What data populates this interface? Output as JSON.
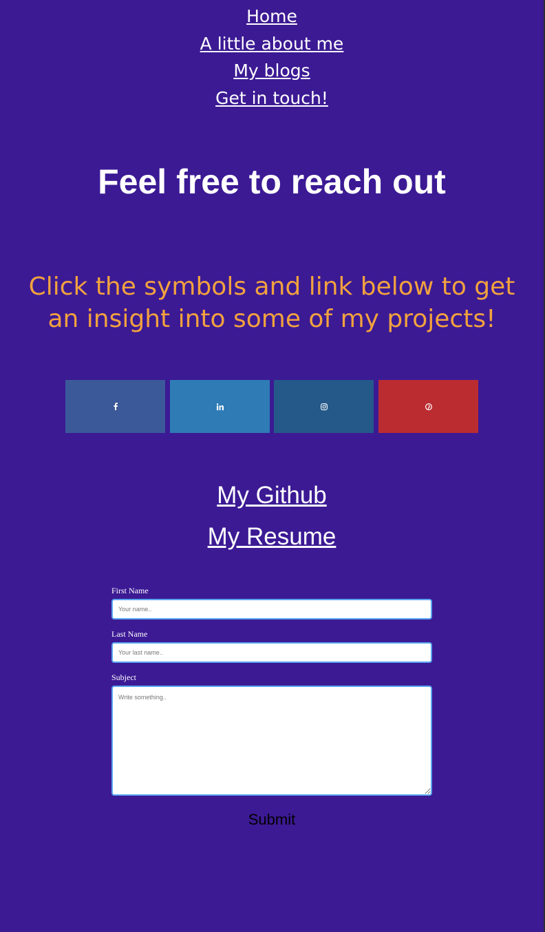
{
  "nav": {
    "items": [
      {
        "label": "Home"
      },
      {
        "label": "A little about me"
      },
      {
        "label": "My blogs"
      },
      {
        "label": "Get in touch!"
      }
    ]
  },
  "main": {
    "heading": "Feel free to reach out",
    "subheading": "Click the symbols and link below to get an insight into some of my projects!"
  },
  "socials": [
    {
      "icon": "facebook-icon",
      "color": "#3b5998"
    },
    {
      "icon": "linkedin-icon",
      "color": "#2f7bb6"
    },
    {
      "icon": "instagram-icon",
      "color": "#24598a"
    },
    {
      "icon": "pinterest-icon",
      "color": "#bb2c31"
    }
  ],
  "links": {
    "github": "My Github",
    "resume": "My Resume"
  },
  "form": {
    "first_name_label": "First Name",
    "first_name_placeholder": "Your name..",
    "last_name_label": "Last Name",
    "last_name_placeholder": "Your last name..",
    "subject_label": "Subject",
    "subject_placeholder": "Write something..",
    "submit_label": "Submit"
  },
  "colors": {
    "background": "#3c1a94",
    "accent_text": "#f2a23f",
    "input_border": "#5aa6f0"
  }
}
